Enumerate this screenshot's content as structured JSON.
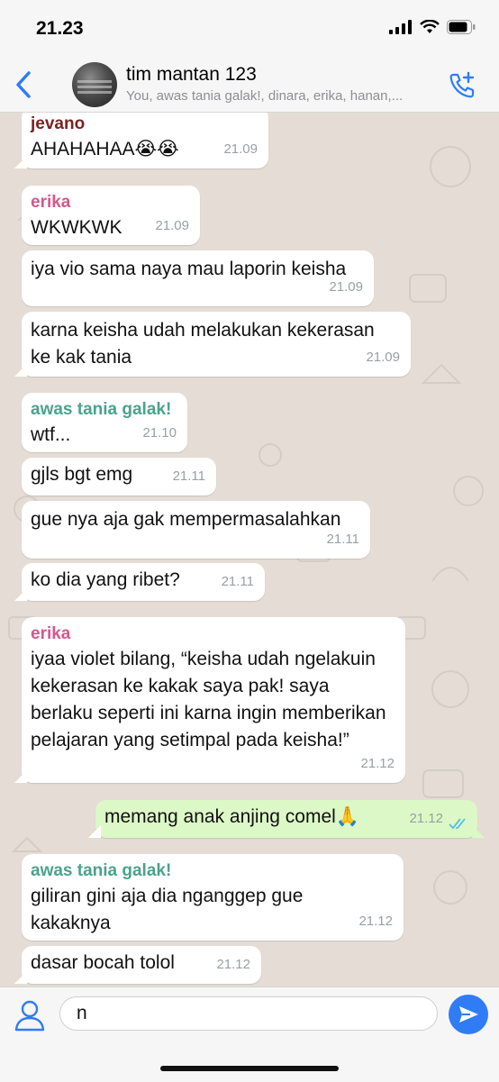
{
  "status": {
    "time": "21.23"
  },
  "header": {
    "title": "tim mantan 123",
    "subtitle": "You, awas tania galak!, dinara, erika, hanan,..."
  },
  "messages": [
    {
      "sender": "jevano",
      "sender_color": "#7a2222",
      "text": "AHAHAHAA😭😭",
      "time": "21.09"
    },
    {
      "sender": "erika",
      "sender_color": "#d3588d",
      "text": "WKWKWK",
      "time": "21.09"
    },
    {
      "text": "iya vio sama naya mau laporin keisha",
      "time": "21.09"
    },
    {
      "text": "karna keisha udah melakukan kekerasan ke kak tania",
      "time": "21.09"
    },
    {
      "sender": "awas tania galak!",
      "sender_color": "#4aa38a",
      "text": "wtf...",
      "time": "21.10"
    },
    {
      "text": "gjls bgt emg",
      "time": "21.11"
    },
    {
      "text": "gue nya aja gak mempermasalahkan",
      "time": "21.11"
    },
    {
      "text": "ko dia yang ribet?",
      "time": "21.11"
    },
    {
      "sender": "erika",
      "sender_color": "#d3588d",
      "text": "iyaa violet bilang, “keisha udah ngelakuin kekerasan ke kakak saya pak! saya berlaku seperti ini karna ingin memberikan pelajaran yang setimpal pada keisha!”",
      "time": "21.12"
    },
    {
      "text": "memang anak anjing comel🙏",
      "time": "21.12",
      "outgoing": true
    },
    {
      "sender": "awas tania galak!",
      "sender_color": "#4aa38a",
      "text": "giliran gini aja dia nganggep gue kakaknya",
      "time": "21.12"
    },
    {
      "text": "dasar bocah tolol",
      "time": "21.12"
    }
  ],
  "input": {
    "value": "n"
  },
  "colors": {
    "accent": "#2f7cf6",
    "chat_bg": "#e5ddd5",
    "outgoing_bubble": "#dcf8c6",
    "read_ticks": "#53bdeb"
  },
  "icons": {
    "back": "chevron-left-icon",
    "add_call": "phone-plus-icon",
    "contact": "person-icon",
    "send": "send-arrow-icon"
  }
}
